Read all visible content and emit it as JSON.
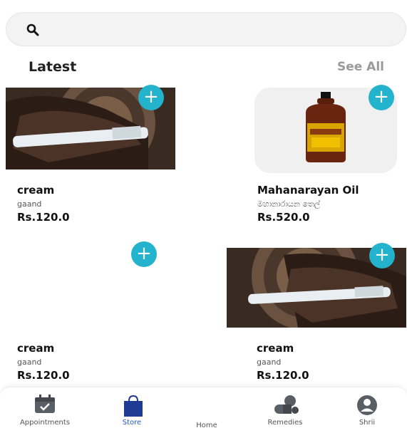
{
  "search": {
    "placeholder": "",
    "icon": "search-icon"
  },
  "section": {
    "title": "Latest",
    "see_all": "See All"
  },
  "products": [
    {
      "name": "cream",
      "subtitle": "gaand",
      "price": "Rs.120.0",
      "image": "cream-tube-photo"
    },
    {
      "name": "Mahanarayan Oil",
      "subtitle": "මහානාරායන තෙල්",
      "price": "Rs.520.0",
      "image": "oil-bottle-photo"
    },
    {
      "name": "cream",
      "subtitle": "gaand",
      "price": "Rs.120.0",
      "image": "none"
    },
    {
      "name": "cream",
      "subtitle": "gaand",
      "price": "Rs.120.0",
      "image": "cream-tube-photo"
    }
  ],
  "add_label": "+",
  "nav": [
    {
      "label": "Appointments",
      "icon": "calendar-icon"
    },
    {
      "label": "Store",
      "icon": "shopping-bag-icon",
      "active": true
    },
    {
      "label": "Home",
      "icon": "home-icon"
    },
    {
      "label": "Remedies",
      "icon": "pills-icon"
    },
    {
      "label": "Shrii",
      "icon": "user-icon"
    }
  ],
  "colors": {
    "accent": "#24b3cc",
    "active_nav": "#2457c7",
    "bag": "#1f3a93"
  }
}
